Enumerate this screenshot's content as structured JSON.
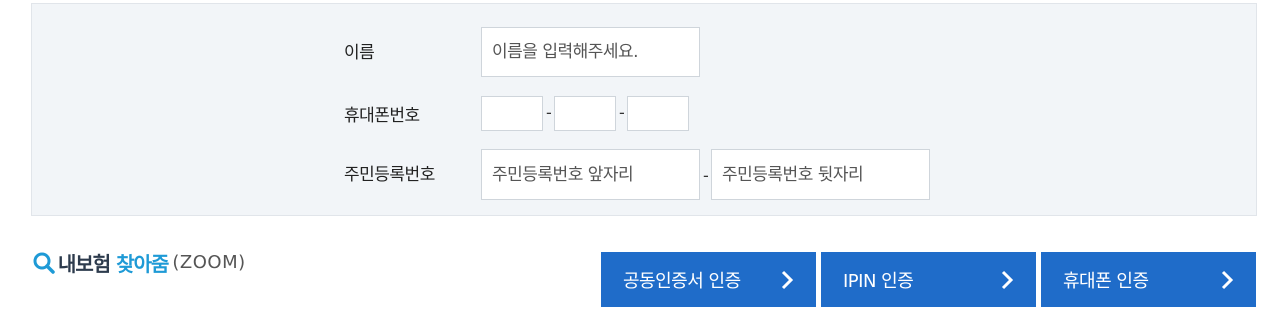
{
  "form": {
    "name_label": "이름",
    "name_placeholder": "이름을 입력해주세요.",
    "phone_label": "휴대폰번호",
    "phone_separator": "-",
    "rrn_label": "주민등록번호",
    "rrn_front_placeholder": "주민등록번호 앞자리",
    "rrn_back_placeholder": "주민등록번호 뒷자리",
    "rrn_separator": "-"
  },
  "logo": {
    "part1": "내보험",
    "part2": "찾아줌",
    "part3": "(ZOOM)",
    "icon": "search-icon",
    "color_dark": "#2d3b4d",
    "color_blue": "#1e9ad6"
  },
  "buttons": [
    {
      "label": "공동인증서 인증",
      "icon": "chevron-right-icon"
    },
    {
      "label": "IPIN 인증",
      "icon": "chevron-right-icon"
    },
    {
      "label": "휴대폰 인증",
      "icon": "chevron-right-icon"
    }
  ],
  "colors": {
    "button_bg": "#1f6cc9",
    "panel_bg": "#f2f5f8"
  }
}
